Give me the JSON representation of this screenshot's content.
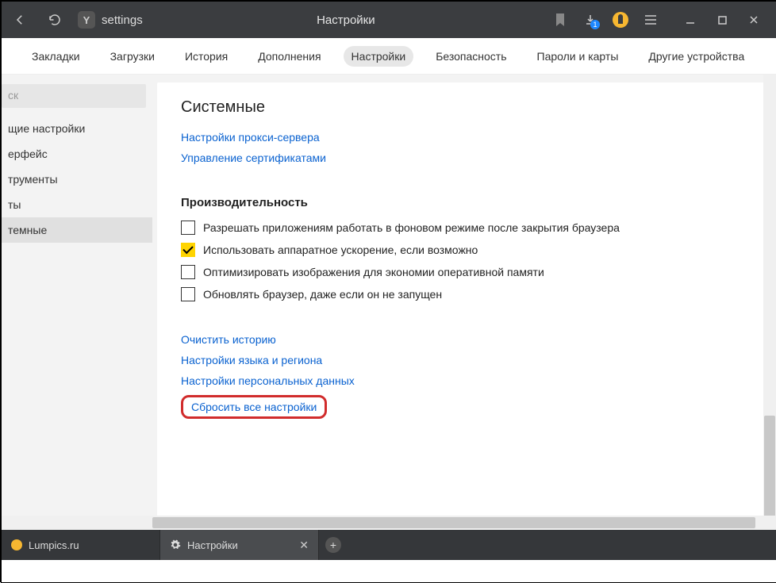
{
  "titlebar": {
    "address": "settings",
    "title": "Настройки",
    "download_badge": "1"
  },
  "navtabs": [
    "Закладки",
    "Загрузки",
    "История",
    "Дополнения",
    "Настройки",
    "Безопасность",
    "Пароли и карты",
    "Другие устройства"
  ],
  "sidebar": {
    "search_placeholder": "ск",
    "items": [
      "щие настройки",
      "ерфейс",
      "трументы",
      "ты",
      "темные"
    ]
  },
  "content": {
    "heading": "Системные",
    "top_links": [
      "Настройки прокси-сервера",
      "Управление сертификатами"
    ],
    "perf_title": "Производительность",
    "perf_options": [
      {
        "label": "Разрешать приложениям работать в фоновом режиме после закрытия браузера",
        "checked": false
      },
      {
        "label": "Использовать аппаратное ускорение, если возможно",
        "checked": true
      },
      {
        "label": "Оптимизировать изображения для экономии оперативной памяти",
        "checked": false
      },
      {
        "label": "Обновлять браузер, даже если он не запущен",
        "checked": false
      }
    ],
    "bottom_links": [
      "Очистить историю",
      "Настройки языка и региона",
      "Настройки персональных данных",
      "Сбросить все настройки"
    ]
  },
  "tabs": [
    {
      "label": "Lumpics.ru",
      "icon": "orange",
      "active": false,
      "closable": false
    },
    {
      "label": "Настройки",
      "icon": "gear",
      "active": true,
      "closable": true
    }
  ]
}
